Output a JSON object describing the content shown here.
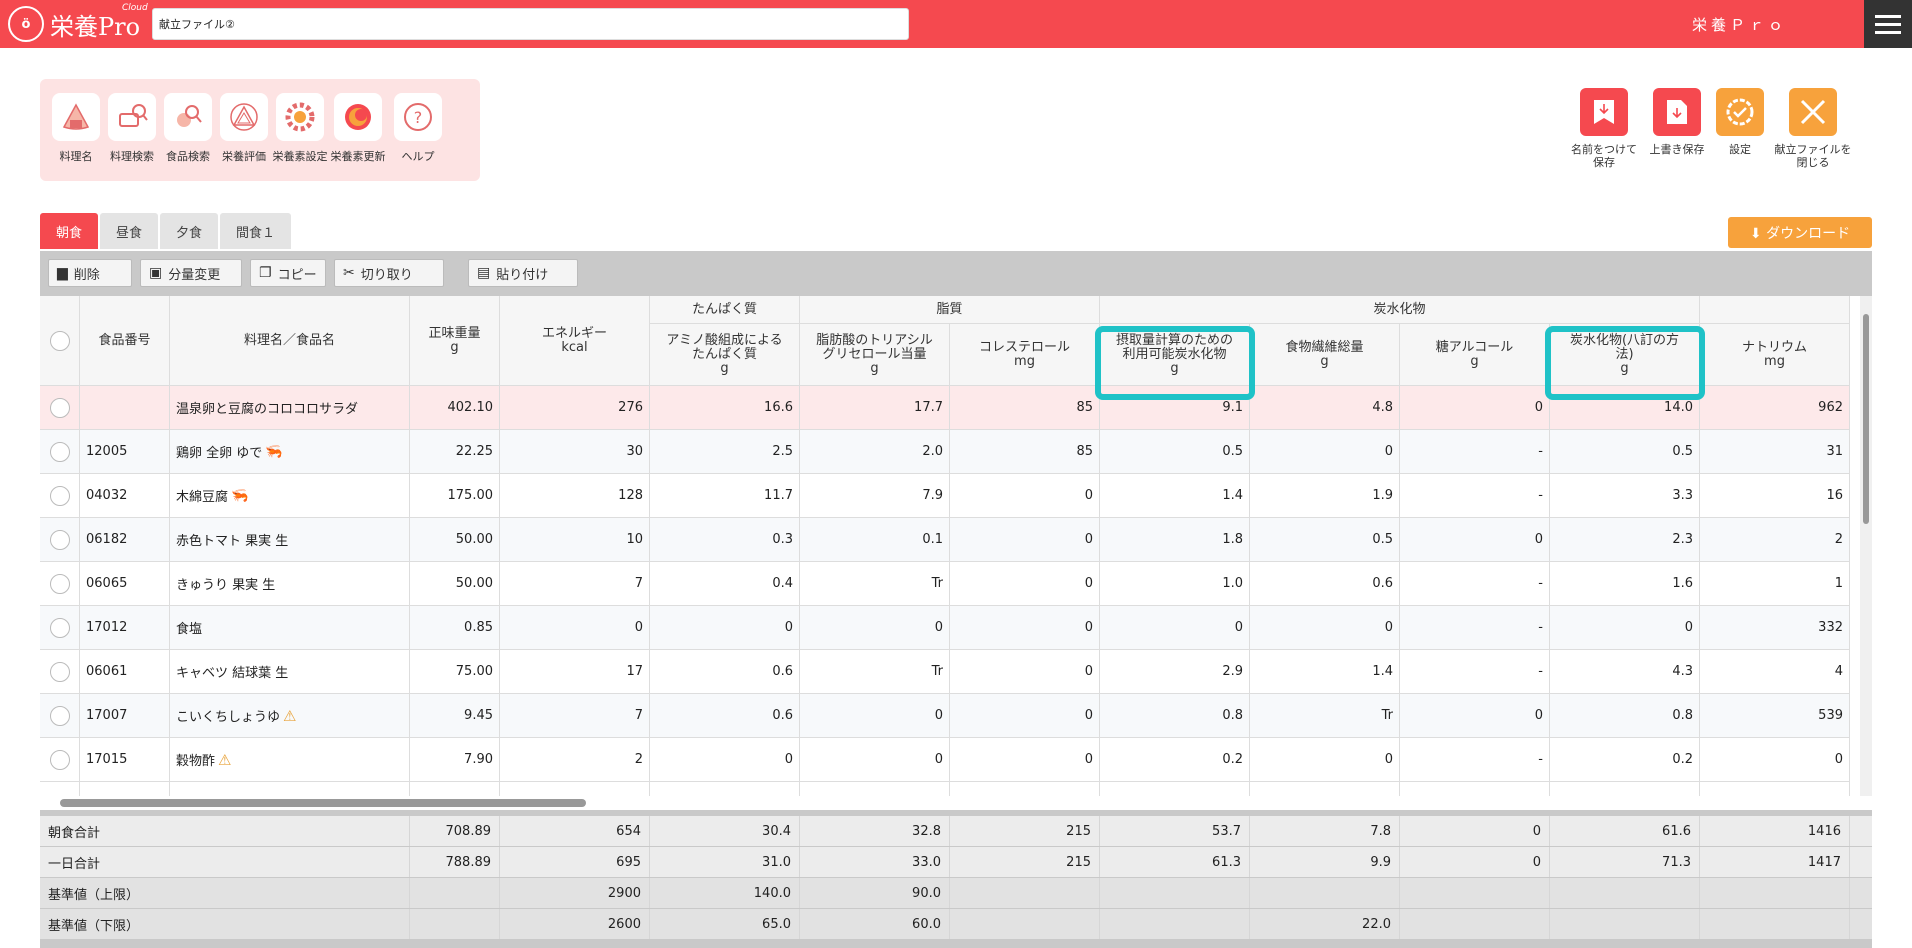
{
  "header": {
    "logo_mark": "ö",
    "logo_text": "栄養Pro",
    "logo_cloud": "Cloud",
    "file_name": "献立ファイル②",
    "app_name": "栄養Ｐｒｏ"
  },
  "tools": [
    {
      "label": "料理名",
      "icon": "rice-ball-icon"
    },
    {
      "label": "料理検索",
      "icon": "pot-search-icon"
    },
    {
      "label": "食品検索",
      "icon": "food-search-icon"
    },
    {
      "label": "栄養評価",
      "icon": "triangle-eval-icon"
    },
    {
      "label": "栄養素設定",
      "icon": "gear-icon"
    },
    {
      "label": "栄養素更新",
      "icon": "refresh-circle-icon"
    },
    {
      "label": "ヘルプ",
      "icon": "question-icon"
    }
  ],
  "actions": [
    {
      "label": "名前をつけて\n保存",
      "icon": "save-as-icon",
      "color": "#f5494f"
    },
    {
      "label": "上書き保存",
      "icon": "overwrite-save-icon",
      "color": "#f5494f"
    },
    {
      "label": "設定",
      "icon": "settings-check-icon",
      "color": "#f7a23c"
    },
    {
      "label": "献立ファイルを\n閉じる",
      "icon": "close-icon",
      "color": "#f7a23c"
    }
  ],
  "meal_tabs": [
    "朝食",
    "昼食",
    "夕食",
    "間食１"
  ],
  "download_label": "⬇ ダウンロード",
  "grid_toolbar": [
    {
      "label": "削除",
      "icon": "delete-icon"
    },
    {
      "label": "分量変更",
      "icon": "scale-icon"
    },
    {
      "label": "コピー",
      "icon": "copy-icon"
    },
    {
      "label": "切り取り",
      "icon": "scissors-icon"
    },
    {
      "label": "貼り付け",
      "icon": "paste-icon"
    }
  ],
  "groups": {
    "protein": "たんぱく質",
    "fat": "脂質",
    "carb": "炭水化物"
  },
  "columns": [
    "食品番号",
    "料理名／食品名",
    "正味重量\ng",
    "エネルギー\nkcal",
    "アミノ酸組成による\nたんぱく質\ng",
    "脂肪酸のトリアシル\nグリセロール当量\ng",
    "コレステロール\nmg",
    "摂取量計算のための\n利用可能炭水化物\ng",
    "食物繊維総量\ng",
    "糖アルコール\ng",
    "炭水化物(八訂の方\n法)\ng",
    "ナトリウム\nmg"
  ],
  "rows": [
    {
      "code": "",
      "name": "温泉卵と豆腐のコロコロサラダ",
      "mark": "",
      "vals": [
        "402.10",
        "276",
        "16.6",
        "17.7",
        "85",
        "9.1",
        "4.8",
        "0",
        "14.0",
        "962"
      ],
      "dish": true
    },
    {
      "code": "12005",
      "name": "鶏卵 全卵 ゆで",
      "mark": "fish",
      "vals": [
        "22.25",
        "30",
        "2.5",
        "2.0",
        "85",
        "0.5",
        "0",
        "-",
        "0.5",
        "31"
      ]
    },
    {
      "code": "04032",
      "name": "木綿豆腐",
      "mark": "fish",
      "vals": [
        "175.00",
        "128",
        "11.7",
        "7.9",
        "0",
        "1.4",
        "1.9",
        "-",
        "3.3",
        "16"
      ]
    },
    {
      "code": "06182",
      "name": "赤色トマト 果実 生",
      "mark": "",
      "vals": [
        "50.00",
        "10",
        "0.3",
        "0.1",
        "0",
        "1.8",
        "0.5",
        "0",
        "2.3",
        "2"
      ]
    },
    {
      "code": "06065",
      "name": "きゅうり 果実 生",
      "mark": "",
      "vals": [
        "50.00",
        "7",
        "0.4",
        "Tr",
        "0",
        "1.0",
        "0.6",
        "-",
        "1.6",
        "1"
      ]
    },
    {
      "code": "17012",
      "name": "食塩",
      "mark": "",
      "vals": [
        "0.85",
        "0",
        "0",
        "0",
        "0",
        "0",
        "0",
        "-",
        "0",
        "332"
      ]
    },
    {
      "code": "06061",
      "name": "キャベツ 結球葉 生",
      "mark": "",
      "vals": [
        "75.00",
        "17",
        "0.6",
        "Tr",
        "0",
        "2.9",
        "1.4",
        "-",
        "4.3",
        "4"
      ]
    },
    {
      "code": "17007",
      "name": "こいくちしょうゆ",
      "mark": "warn",
      "vals": [
        "9.45",
        "7",
        "0.6",
        "0",
        "0",
        "0.8",
        "Tr",
        "0",
        "0.8",
        "539"
      ]
    },
    {
      "code": "17015",
      "name": "穀物酢",
      "mark": "warn",
      "vals": [
        "7.90",
        "2",
        "0",
        "0",
        "0",
        "0.2",
        "0",
        "-",
        "0.2",
        "0"
      ]
    }
  ],
  "summary": [
    {
      "label": "朝食合計",
      "vals": [
        "708.89",
        "654",
        "30.4",
        "32.8",
        "215",
        "53.7",
        "7.8",
        "0",
        "61.6",
        "1416"
      ]
    },
    {
      "label": "一日合計",
      "vals": [
        "788.89",
        "695",
        "31.0",
        "33.0",
        "215",
        "61.3",
        "9.9",
        "0",
        "71.3",
        "1417"
      ]
    },
    {
      "label": "基準値（上限）",
      "vals": [
        "",
        "2900",
        "140.0",
        "90.0",
        "",
        "",
        "",
        "",
        "",
        ""
      ]
    },
    {
      "label": "基準値（下限）",
      "vals": [
        "",
        "2600",
        "65.0",
        "60.0",
        "",
        "",
        "22.0",
        "",
        "",
        ""
      ]
    }
  ]
}
